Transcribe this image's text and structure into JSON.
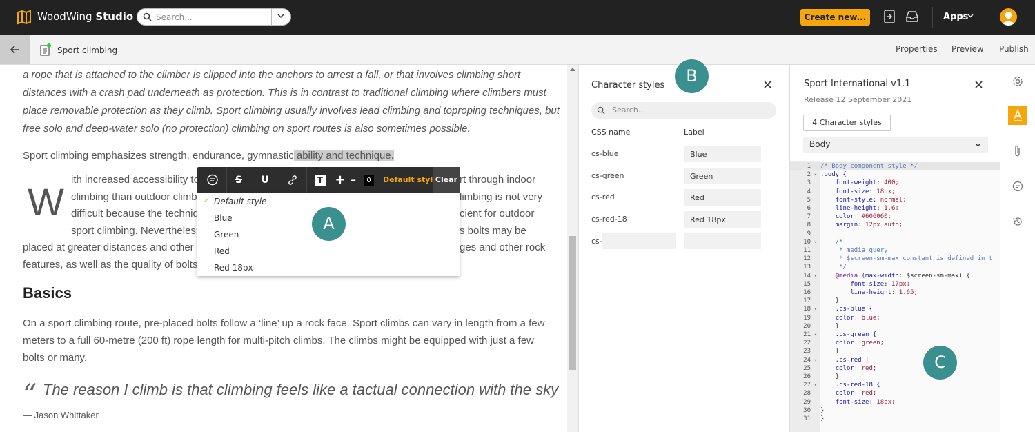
{
  "topbar": {
    "brand_normal": "WoodWing",
    "brand_bold": "Studio",
    "search_placeholder": "Search...",
    "create_label": "Create new...",
    "apps_label": "Apps",
    "icons": [
      "logo-icon",
      "search-icon",
      "chevron-down-icon",
      "export-icon",
      "inbox-icon",
      "avatar"
    ]
  },
  "subbar": {
    "doc_title": "Sport climbing",
    "tabs": [
      "Properties",
      "Preview",
      "Publish"
    ]
  },
  "editor": {
    "intro_lines": [
      "a rope that is attached to the climber is clipped into the anchors to arrest a fall, or that involves climbing short",
      "distances with a crash pad underneath as protection. This is in contrast to traditional climbing where climbers must",
      "place removable protection as they climb. Sport climbing usually involves lead climbing and toproping techniques, but",
      "free solo and deep-water solo (no protection) climbing on sport routes is also sometimes possible."
    ],
    "emphasis_pre": "Sport climbing emphasizes strength, endurance, gymnastic",
    "emphasis_hl": " ability and technique.",
    "dropcap": "W",
    "dc_lines_left": [
      "ith increased accessibility to",
      "climbing than outdoor climbi",
      "difficult because the techniq",
      "sport climbing. Nevertheless",
      "placed at greater distances and other ri",
      "features, as well as the quality of bolts a"
    ],
    "dc_lines_right": [
      "rt through indoor",
      "limbing is not very",
      "cient for outdoor",
      "s bolts may be",
      "ges and other rock"
    ],
    "heading": "Basics",
    "basics_lines": [
      "On a sport climbing route, pre-placed bolts follow a ‘line’ up a rock face. Sport climbs can vary in length from a few",
      "meters to a full 60-metre (200 ft) rope length for multi-pitch climbs. The climbs might be equipped with just a few",
      "bolts or many."
    ],
    "quote_mark": "“",
    "quote": "The reason I climb is that climbing feels like a tactual connection with the sky",
    "author": "— Jason Whittaker"
  },
  "toolbar": {
    "s_label": "S",
    "u_label": "U",
    "t_label": "T",
    "plus": "+",
    "minus": "–",
    "size": "0",
    "style_label": "Default style",
    "clear_label": "Clear"
  },
  "style_menu": {
    "items": [
      "Default style",
      "Blue",
      "Green",
      "Red",
      "Red 18px"
    ],
    "check": "✓"
  },
  "badges": {
    "a": "A",
    "b": "B",
    "c": "C"
  },
  "char_styles_panel": {
    "title": "Character styles",
    "search_placeholder": "Search...",
    "col_css": "CSS name",
    "col_label": "Label",
    "rows": [
      {
        "css": "cs-blue",
        "label": "Blue"
      },
      {
        "css": "cs-green",
        "label": "Green"
      },
      {
        "css": "cs-red",
        "label": "Red"
      },
      {
        "css": "cs-red-18",
        "label": "Red 18px"
      }
    ],
    "new_prefix": "cs-"
  },
  "style_panel": {
    "title": "Sport International v1.1",
    "release": "Release 12 September 2021",
    "styles_button": "4 Character styles",
    "component": "Body"
  },
  "code": [
    {
      "n": "1",
      "f": "",
      "t": "/* Body component style */"
    },
    {
      "n": "2",
      "f": "▾",
      "t": ".body {"
    },
    {
      "n": "3",
      "f": "",
      "t": "    font-weight: 400;"
    },
    {
      "n": "4",
      "f": "",
      "t": "    font-size: 18px;"
    },
    {
      "n": "5",
      "f": "",
      "t": "    font-style: normal;"
    },
    {
      "n": "6",
      "f": "",
      "t": "    line-height: 1.6;"
    },
    {
      "n": "7",
      "f": "",
      "t": "    color: #606060;"
    },
    {
      "n": "8",
      "f": "",
      "t": "    margin: 12px auto;"
    },
    {
      "n": "9",
      "f": "",
      "t": ""
    },
    {
      "n": "10",
      "f": "▾",
      "t": "    /*"
    },
    {
      "n": "11",
      "f": "",
      "t": "     * media query"
    },
    {
      "n": "12",
      "f": "",
      "t": "     * $screen-sm-max constant is defined in t"
    },
    {
      "n": "13",
      "f": "",
      "t": "     */"
    },
    {
      "n": "14",
      "f": "▾",
      "t": "    @media (max-width: $screen-sm-max) {"
    },
    {
      "n": "15",
      "f": "",
      "t": "        font-size: 17px;"
    },
    {
      "n": "16",
      "f": "",
      "t": "        line-height: 1.65;"
    },
    {
      "n": "17",
      "f": "",
      "t": "    }"
    },
    {
      "n": "18",
      "f": "▾",
      "t": "    .cs-blue {"
    },
    {
      "n": "19",
      "f": "",
      "t": "    color: blue;"
    },
    {
      "n": "20",
      "f": "",
      "t": "    }"
    },
    {
      "n": "21",
      "f": "▾",
      "t": "    .cs-green {"
    },
    {
      "n": "22",
      "f": "",
      "t": "    color: green;"
    },
    {
      "n": "23",
      "f": "",
      "t": "    }"
    },
    {
      "n": "24",
      "f": "▾",
      "t": "    .cs-red {"
    },
    {
      "n": "25",
      "f": "",
      "t": "    color: red;"
    },
    {
      "n": "26",
      "f": "",
      "t": "    }"
    },
    {
      "n": "27",
      "f": "▾",
      "t": "    .cs-red-18 {"
    },
    {
      "n": "28",
      "f": "",
      "t": "    color: red;"
    },
    {
      "n": "29",
      "f": "",
      "t": "    font-size: 18px;"
    },
    {
      "n": "30",
      "f": "",
      "t": "}"
    },
    {
      "n": "31",
      "f": "",
      "t": "}"
    }
  ],
  "rail_icons": [
    "gear-icon",
    "text-style-icon",
    "paperclip-icon",
    "comment-icon",
    "history-icon"
  ],
  "colors": {
    "accent": "#f5a60a",
    "badge": "#3a8f8f",
    "topbar": "#222222"
  }
}
